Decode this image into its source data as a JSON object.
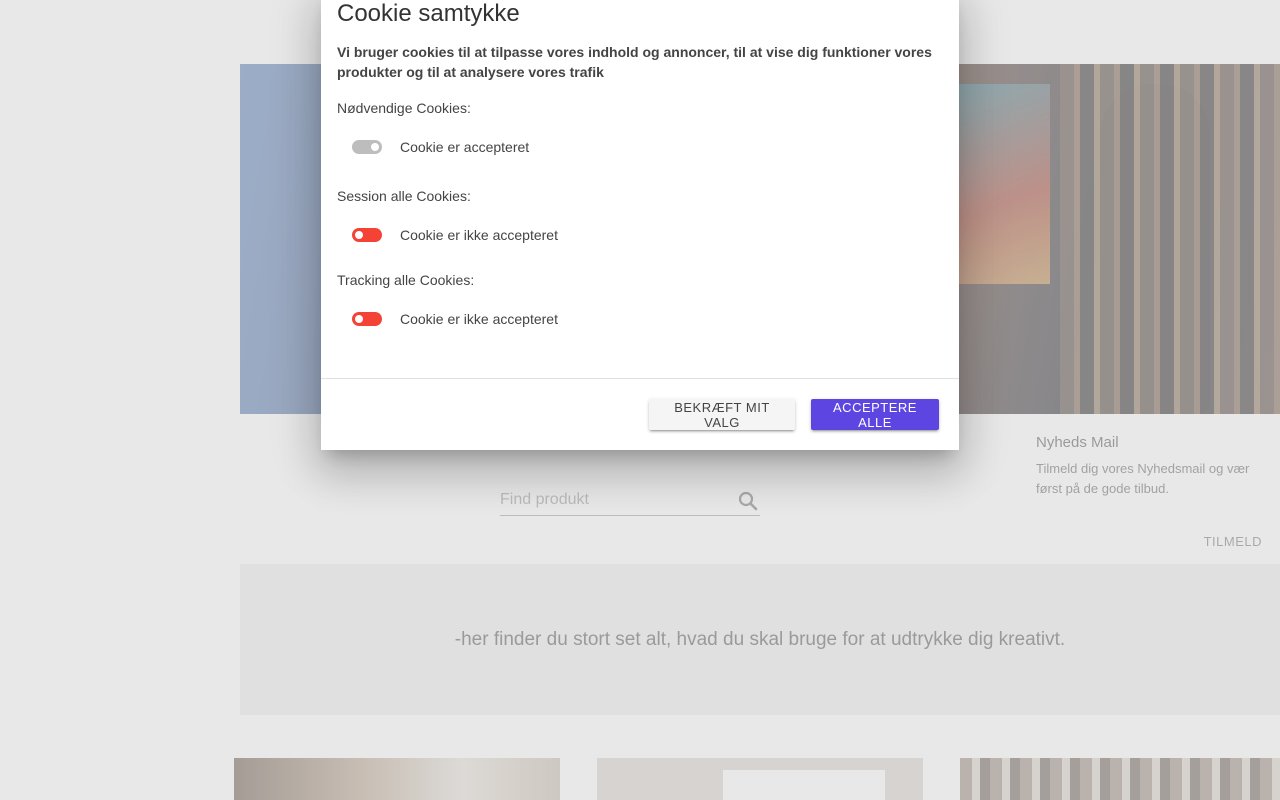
{
  "background": {
    "search": {
      "placeholder": "Find produkt",
      "icon": "search-icon"
    },
    "newsletter": {
      "title": "Nyheds Mail",
      "text": "Tilmeld dig vores Nyhedsmail og vær først på de gode tilbud.",
      "button_label": "TILMELD"
    },
    "tagline": "-her finder du stort set alt, hvad du skal bruge for at udtrykke dig kreativt."
  },
  "cookie_dialog": {
    "title": "Cookie samtykke",
    "intro": "Vi bruger cookies til at tilpasse vores indhold og annoncer, til at vise dig funktioner vores produkter og til at analysere vores trafik",
    "sections": [
      {
        "label": "Nødvendige Cookies:",
        "status": "Cookie er accepteret",
        "state": "disabled-on"
      },
      {
        "label": "Session alle Cookies:",
        "status": "Cookie er ikke accepteret",
        "state": "off"
      },
      {
        "label": "Tracking alle Cookies:",
        "status": "Cookie er ikke accepteret",
        "state": "off"
      }
    ],
    "buttons": {
      "confirm": "BEKRÆFT MIT VALG",
      "accept_all": "ACCEPTERE ALLE"
    },
    "colors": {
      "accept_button": "#5c45e0",
      "toggle_off": "#f44336",
      "toggle_disabled": "#bdbdbd"
    }
  }
}
